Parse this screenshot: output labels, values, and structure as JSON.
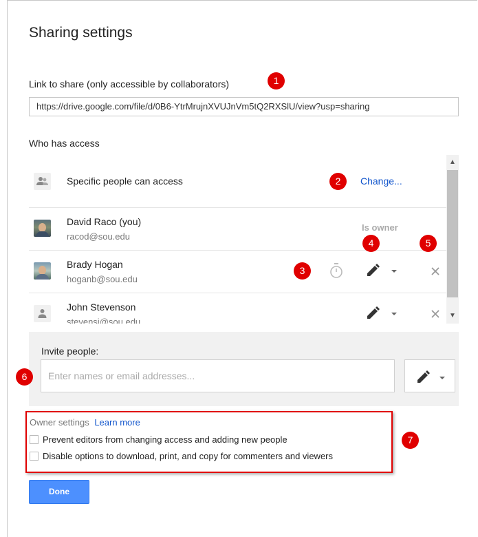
{
  "dialog": {
    "title": "Sharing settings"
  },
  "link": {
    "label": "Link to share (only accessible by collaborators)",
    "url": "https://drive.google.com/file/d/0B6-YtrMrujnXVUJnVm5tQ2RXSlU/view?usp=sharing"
  },
  "access": {
    "label": "Who has access",
    "visibility": {
      "text": "Specific people can access",
      "change_label": "Change..."
    },
    "people": [
      {
        "name": "David Raco (you)",
        "email": "racod@sou.edu",
        "role": "Is owner"
      },
      {
        "name": "Brady Hogan",
        "email": "hoganb@sou.edu",
        "role_icon": "pencil-icon"
      },
      {
        "name": "John Stevenson",
        "email": "stevensj@sou.edu",
        "role_icon": "pencil-icon"
      }
    ]
  },
  "invite": {
    "label": "Invite people:",
    "placeholder": "Enter names or email addresses..."
  },
  "owner_settings": {
    "heading": "Owner settings",
    "learn_more": "Learn more",
    "options": [
      {
        "label": "Prevent editors from changing access and adding new people",
        "checked": false
      },
      {
        "label": "Disable options to download, print, and copy for commenters and viewers",
        "checked": false
      }
    ]
  },
  "done_label": "Done",
  "annotations": [
    "1",
    "2",
    "3",
    "4",
    "5",
    "6",
    "7"
  ],
  "colors": {
    "accent": "#4d90fe",
    "link": "#1155cc",
    "annotation": "#e00000"
  }
}
